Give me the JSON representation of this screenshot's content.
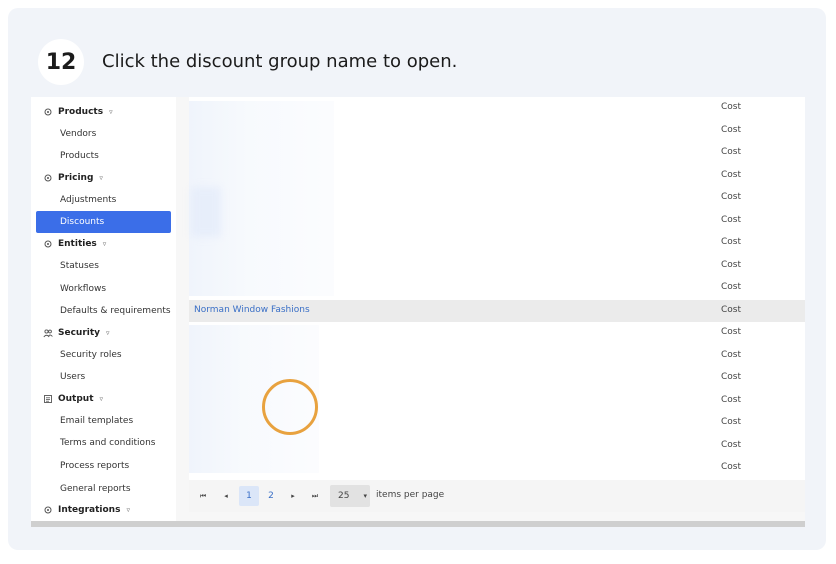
{
  "step": {
    "number": "12",
    "instruction": "Click the discount group name to open."
  },
  "sidebar": {
    "products": {
      "label": "Products",
      "items": [
        "Vendors",
        "Products"
      ]
    },
    "pricing": {
      "label": "Pricing",
      "items": [
        "Adjustments",
        "Discounts"
      ]
    },
    "entities": {
      "label": "Entities",
      "items": [
        "Statuses",
        "Workflows",
        "Defaults & requirements"
      ]
    },
    "security": {
      "label": "Security",
      "items": [
        "Security roles",
        "Users"
      ]
    },
    "output": {
      "label": "Output",
      "items": [
        "Email templates",
        "Terms and conditions",
        "Process reports",
        "General reports"
      ]
    },
    "integrations": {
      "label": "Integrations"
    },
    "active_item": "Discounts",
    "chevron": "▿"
  },
  "table": {
    "rows": [
      {
        "name": "",
        "type": "Cost"
      },
      {
        "name": "",
        "type": "Cost"
      },
      {
        "name": "",
        "type": "Cost"
      },
      {
        "name": "",
        "type": "Cost"
      },
      {
        "name": "",
        "type": "Cost"
      },
      {
        "name": "",
        "type": "Cost"
      },
      {
        "name": "",
        "type": "Cost"
      },
      {
        "name": "",
        "type": "Cost"
      },
      {
        "name": "",
        "type": "Cost"
      },
      {
        "name": "Norman Window Fashions",
        "type": "Cost",
        "highlighted": true
      },
      {
        "name": "",
        "type": "Cost"
      },
      {
        "name": "",
        "type": "Cost"
      },
      {
        "name": "",
        "type": "Cost"
      },
      {
        "name": "",
        "type": "Cost"
      },
      {
        "name": "",
        "type": "Cost"
      },
      {
        "name": "",
        "type": "Cost"
      },
      {
        "name": "",
        "type": "Cost"
      }
    ]
  },
  "pager": {
    "first_icon": "⏮",
    "prev_icon": "◂",
    "pages": [
      "1",
      "2"
    ],
    "current_page": "1",
    "next_icon": "▸",
    "last_icon": "⏭",
    "page_size": "25",
    "page_size_caret": "▾",
    "items_per_page_label": "items per page"
  },
  "colors": {
    "accent": "#3b6ee8",
    "link": "#3a6fc6",
    "click_ring": "#e8a23f"
  }
}
